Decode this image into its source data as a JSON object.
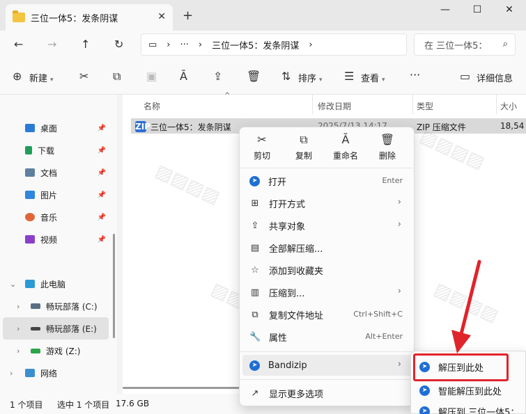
{
  "window": {
    "tab_title": "三位一体5：发条阴谋",
    "newtab": "+",
    "close": "✕",
    "minimize": "—",
    "maximize": "☐",
    "winclose": "✕"
  },
  "address": {
    "crumbs": [
      "三位一体5：发条阴谋"
    ],
    "search_placeholder": "在 三位一体5："
  },
  "toolbar": {
    "new_label": "新建",
    "sort_label": "排序",
    "view_label": "查看",
    "more_label": "···",
    "details_label": "详细信息"
  },
  "sidebar": {
    "items": [
      {
        "label": "桌面",
        "color": "#2b7bd6"
      },
      {
        "label": "下载",
        "color": "#1e9e5a"
      },
      {
        "label": "文档",
        "color": "#5f7f9e"
      },
      {
        "label": "图片",
        "color": "#2e86de"
      },
      {
        "label": "音乐",
        "color": "#e0663a"
      },
      {
        "label": "视频",
        "color": "#8b3fc9"
      }
    ],
    "thispc": "此电脑",
    "drives": [
      "畅玩部落 (C:)",
      "畅玩部落 (E:)",
      "游戏 (Z:)"
    ],
    "network": "网络"
  },
  "filelist": {
    "columns": [
      "名称",
      "修改日期",
      "类型",
      "大小"
    ],
    "rows": [
      {
        "name": "三位一体5：发条阴谋",
        "date": "2025/7/13 14:17",
        "type": "ZIP 压缩文件",
        "size": "18,54"
      }
    ]
  },
  "status": {
    "count": "1 个项目",
    "selected": "选中 1 个项目",
    "size": "17.6 GB"
  },
  "context_menu": {
    "actions": [
      "剪切",
      "复制",
      "重命名",
      "删除"
    ],
    "items": [
      {
        "label": "打开",
        "shortcut": "Enter"
      },
      {
        "label": "打开方式",
        "shortcut": ""
      },
      {
        "label": "共享对象",
        "shortcut": ""
      },
      {
        "label": "全部解压缩...",
        "shortcut": ""
      },
      {
        "label": "添加到收藏夹",
        "shortcut": ""
      },
      {
        "label": "压缩到...",
        "shortcut": ""
      },
      {
        "label": "复制文件地址",
        "shortcut": "Ctrl+Shift+C"
      },
      {
        "label": "属性",
        "shortcut": "Alt+Enter"
      },
      {
        "label": "Bandizip",
        "shortcut": ""
      },
      {
        "label": "显示更多选项",
        "shortcut": ""
      }
    ]
  },
  "submenu": {
    "items": [
      "解压到此处",
      "智能解压到此处",
      "解压到 三位一体5："
    ]
  },
  "colors": {
    "accent": "#1f6ed4",
    "highlight": "#e0242b"
  }
}
